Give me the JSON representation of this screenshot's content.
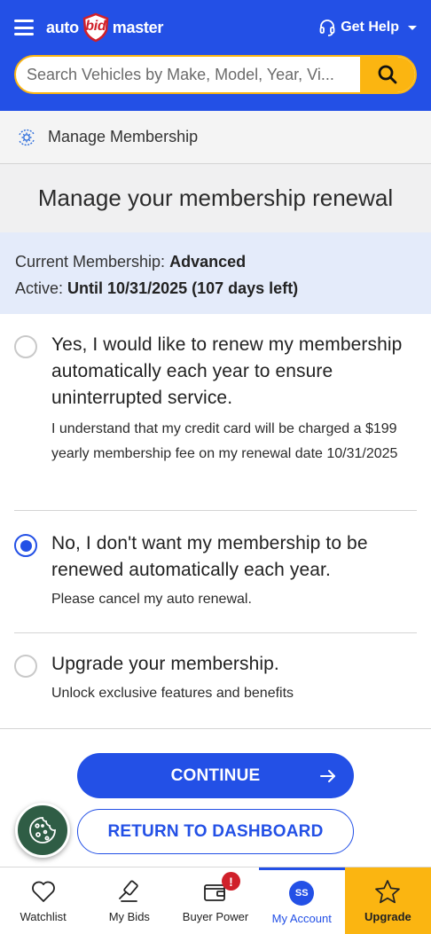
{
  "header": {
    "logo": {
      "part1": "auto",
      "part2": "bid",
      "part3": "master"
    },
    "help_label": "Get Help",
    "search_placeholder": "Search Vehicles by Make, Model, Year, Vi..."
  },
  "breadcrumb": {
    "label": "Manage Membership",
    "icon": "gear-cycle-icon"
  },
  "page_title": "Manage your membership renewal",
  "membership": {
    "current_label": "Current Membership:",
    "current_value": "Advanced",
    "active_label": "Active:",
    "active_value": "Until 10/31/2025 (107 days left)"
  },
  "options": [
    {
      "main": "Yes, I would like to renew my membership automatically each year to ensure uninterrupted service.",
      "sub": "I understand that my credit card will be charged a $199 yearly membership fee on my renewal date 10/31/2025",
      "checked": false
    },
    {
      "main": "No, I don't want my membership to be renewed automatically each year.",
      "sub": "Please cancel my auto renewal.",
      "checked": true
    },
    {
      "main": "Upgrade your membership.",
      "sub": "Unlock exclusive features and benefits",
      "checked": false
    }
  ],
  "buttons": {
    "continue": "CONTINUE",
    "return": "RETURN TO DASHBOARD"
  },
  "bottom_nav": {
    "watchlist": "Watchlist",
    "my_bids": "My Bids",
    "buyer_power": "Buyer Power",
    "buyer_power_badge": "!",
    "my_account": "My Account",
    "avatar_initials": "SS",
    "upgrade": "Upgrade"
  },
  "colors": {
    "brand_blue": "#2350e6",
    "accent_yellow": "#fbb511",
    "alert_red": "#d0202a",
    "cookie_green": "#2f5d45"
  }
}
